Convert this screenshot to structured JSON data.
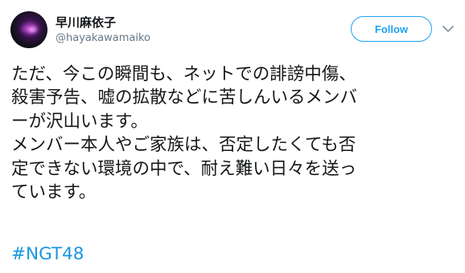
{
  "user": {
    "display_name": "早川麻依子",
    "handle": "@hayakawamaiko"
  },
  "follow_button": {
    "label": "Follow"
  },
  "icons": {
    "menu": "chevron-down-icon",
    "avatar": "avatar"
  },
  "colors": {
    "accent": "#1da1f2",
    "hashtag": "#1b95e0",
    "text": "#14171a",
    "muted": "#657786"
  },
  "tweet": {
    "lines": [
      "ただ、今この瞬間も、ネットでの誹謗中傷、",
      "殺害予告、嘘の拡散などに苦しんいるメンバ",
      "ーが沢山います。",
      "メンバー本人やご家族は、否定したくても否",
      "定できない環境の中で、耐え難い日々を送っ",
      "ています。"
    ],
    "hashtag": "#NGT48"
  }
}
